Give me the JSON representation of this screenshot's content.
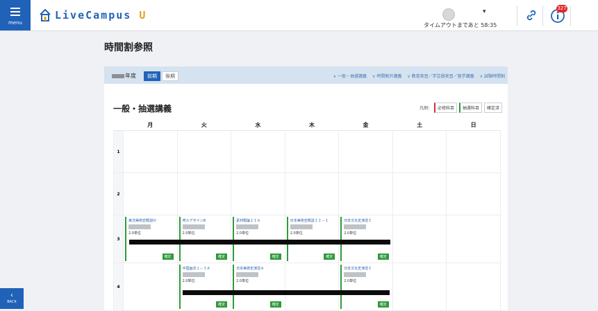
{
  "header": {
    "menu_label": "menu",
    "brand_main": "LiveCampus",
    "brand_suffix": "U",
    "user_caret": "▾",
    "timeout_text": "タイムアウトまであと 58:35",
    "notification_count": "327"
  },
  "back_label": "BACK",
  "page_title": "時間割参照",
  "subbar": {
    "year_suffix": "年度",
    "terms": [
      "前期",
      "後期"
    ],
    "links": [
      "一般・抽選講義",
      "時間割外講義",
      "教育実習／学芸員実習／留学講義",
      "試験時間割"
    ]
  },
  "section_title": "一般・抽選講義",
  "legend": {
    "label": "凡例：",
    "items": [
      "必修科目",
      "抽選科目",
      "確定済"
    ]
  },
  "days": [
    "月",
    "火",
    "水",
    "木",
    "金",
    "土",
    "日"
  ],
  "periods": [
    "1",
    "2",
    "3",
    "4"
  ],
  "status_label": "確定",
  "timetable": {
    "period3": [
      {
        "name": "東洋美術史概説IV",
        "credits": "2.0単位"
      },
      {
        "name": "売ルデザインB",
        "credits": "2.0単位"
      },
      {
        "name": "素材概論ＩＩｂ",
        "credits": "2.0単位"
      },
      {
        "name": "日本美術史概説ＩＩ－１",
        "credits": "2.0単位"
      },
      {
        "name": "日本文化史演習Ｉ",
        "credits": "2.0単位"
      }
    ],
    "period4": [
      {
        "name": "中国画法１－３Ａ",
        "credits": "2.0単位"
      },
      {
        "name": "日本美術史演習Ａ",
        "credits": "2.0単位"
      },
      {
        "name": "日本文化史演習Ｉ",
        "credits": "2.0単位"
      }
    ]
  },
  "colors": {
    "accent": "#1f62b8",
    "lottery": "#2e9a3a",
    "required": "#d12e2e",
    "badge": "#e0262c"
  }
}
